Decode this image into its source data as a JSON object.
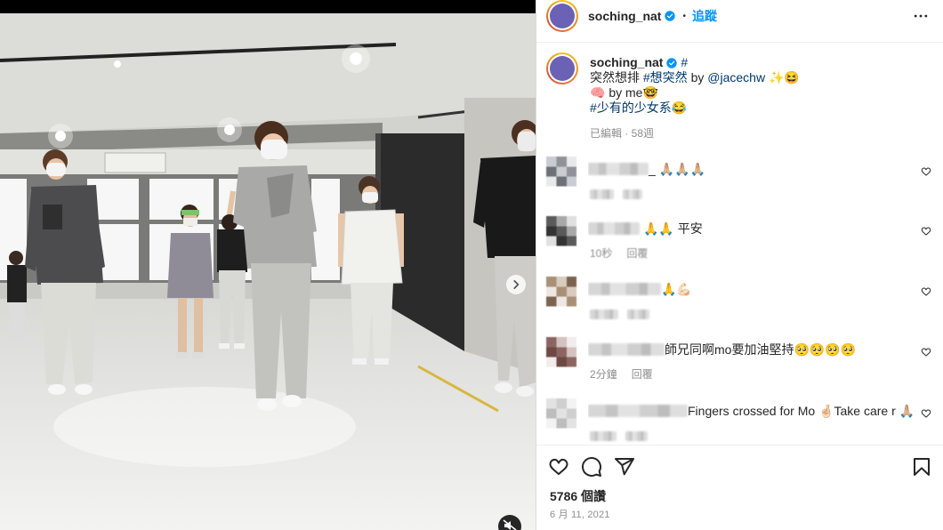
{
  "header": {
    "username": "soching_nat",
    "separator": "•",
    "follow_label": "追蹤"
  },
  "caption": {
    "username": "soching_nat",
    "tag": "#",
    "line1": {
      "t1": "突然想排 ",
      "hashtag": "#想突然",
      "t2": " by ",
      "mention": "@jacechw",
      "t3": " ✨😆"
    },
    "line2": "🧠 by me🤓",
    "line3": {
      "hashtag": "#少有的少女系",
      "t1": "😂"
    },
    "meta": "已編輯 · 58週"
  },
  "comments": [
    {
      "text": "_ 🙏🏼🙏🏼🙏🏼"
    },
    {
      "text": "🙏🙏 平安",
      "time": "10秒",
      "reply": "回覆"
    },
    {
      "text": "🙏💪🏻"
    },
    {
      "text": "師兄同啊mo要加油堅持🥺🥺🥺🥺",
      "time": "2分鐘",
      "reply": "回覆"
    },
    {
      "text": "Fingers crossed for Mo 🤞🏻Take care r 🙏🏼"
    }
  ],
  "likes": "5786 個讚",
  "date": "6 月 11, 2021",
  "icons": {
    "verified": "verified-badge-icon",
    "more": "more-horizontal-icon",
    "like": "heart-outline-icon",
    "comment": "comment-bubble-icon",
    "share": "paper-plane-icon",
    "save": "bookmark-icon",
    "next": "chevron-right-icon",
    "mute": "speaker-muted-icon"
  },
  "colors": {
    "accent": "#0095f6",
    "link": "#00376b",
    "text": "#262626",
    "muted": "#8e8e8e",
    "avatar": "#6b62b5"
  }
}
